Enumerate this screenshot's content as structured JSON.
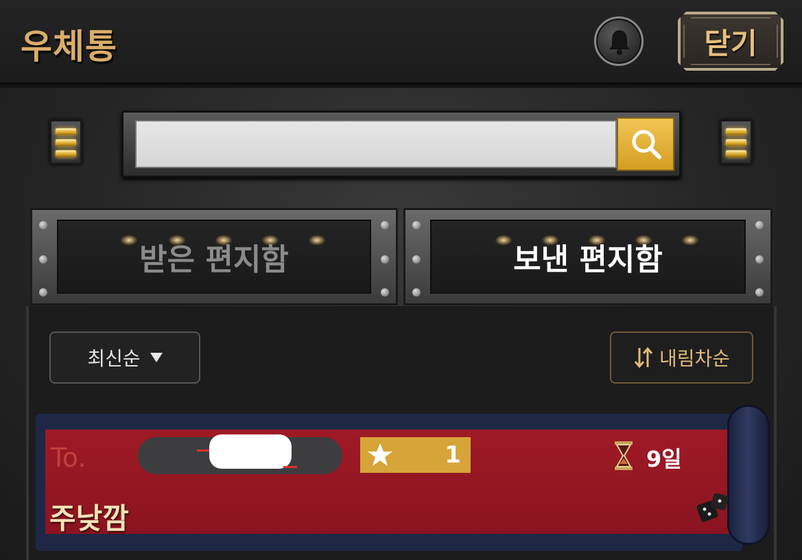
{
  "header": {
    "title": "우체통",
    "close_label": "닫기",
    "bell_icon": "bell-icon"
  },
  "search": {
    "value": "",
    "placeholder": "",
    "icon": "search-icon"
  },
  "tabs": [
    {
      "label": "받은 편지함",
      "active": false
    },
    {
      "label": "보낸 편지함",
      "active": true
    }
  ],
  "sort": {
    "label": "최신순",
    "order_label": "내림차순"
  },
  "mails": [
    {
      "to_label": "To.",
      "stars": "1",
      "days_left": "9일",
      "subject": "주낮깜"
    }
  ],
  "colors": {
    "accent_gold": "#d9ad6a",
    "card_red": "#9f1a25",
    "star_box": "#d7a43a"
  }
}
